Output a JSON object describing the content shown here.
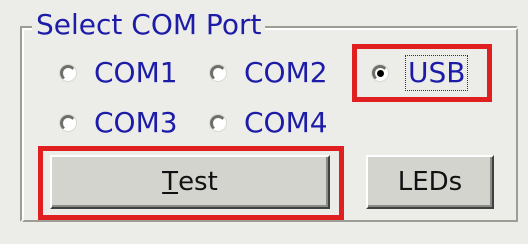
{
  "groupbox": {
    "title": "Select COM Port"
  },
  "radios": [
    {
      "label": "COM1",
      "checked": false
    },
    {
      "label": "COM2",
      "checked": false
    },
    {
      "label": "USB",
      "checked": true
    },
    {
      "label": "COM3",
      "checked": false
    },
    {
      "label": "COM4",
      "checked": false
    }
  ],
  "buttons": {
    "test_accel": "T",
    "test_rest": "est",
    "leds_label": "LEDs"
  },
  "highlights": {
    "color": "#e02020"
  },
  "colors": {
    "label_text": "#1c1ca8",
    "window_bg": "#ecece8",
    "button_face": "#d4d4cf"
  }
}
